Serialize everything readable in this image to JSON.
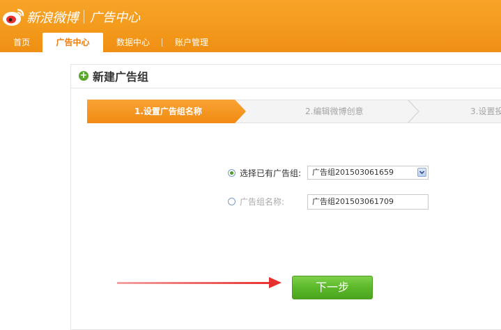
{
  "brand": {
    "name": "新浪微博",
    "section": "广告中心"
  },
  "nav": {
    "items": [
      {
        "label": "首页"
      },
      {
        "label": "广告中心",
        "active": true
      },
      {
        "label": "数据中心"
      },
      {
        "label": "账户管理"
      }
    ]
  },
  "panel": {
    "title": "新建广告组"
  },
  "steps": [
    {
      "label": "1.设置广告组名称",
      "active": true
    },
    {
      "label": "2.编辑微博创意"
    },
    {
      "label": "3.设置投"
    }
  ],
  "form": {
    "existing": {
      "label": "选择已有广告组:",
      "value": "广告组201503061659",
      "checked": true
    },
    "new": {
      "label": "广告组名称:",
      "value": "广告组201503061709",
      "checked": false
    }
  },
  "actions": {
    "next_label": "下一步"
  },
  "colors": {
    "header": "#f39a1c",
    "accent": "#f07b0a",
    "button": "#5cb82a",
    "arrow": "#e5302d"
  },
  "icons": [
    "weibo-logo-icon",
    "plus-circle-icon",
    "chevron-down-icon",
    "arrow-right-icon"
  ]
}
